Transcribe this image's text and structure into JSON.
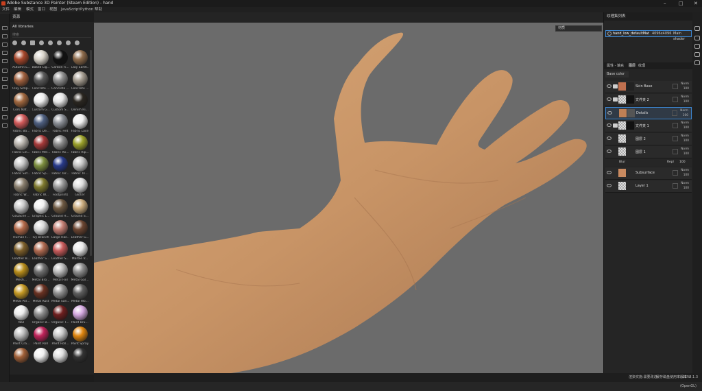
{
  "window": {
    "title": "Adobe Substance 3D Painter (Steam Edition) - hand",
    "minimize": "–",
    "maximize": "□",
    "close": "✕"
  },
  "menu": [
    "文件",
    "编辑",
    "模式",
    "窗口",
    "视图",
    "JavaScript",
    "Python",
    "帮助"
  ],
  "shelf": {
    "title": "资源",
    "path": "All libraries",
    "search_placeholder": "搜索",
    "items": [
      {
        "label": "Autumn L...",
        "color": "#a8472b"
      },
      {
        "label": "Baked Lig...",
        "color": "#d7d2c8"
      },
      {
        "label": "Carbon Fi...",
        "color": "#111111"
      },
      {
        "label": "Clay Earth...",
        "color": "#8d6a4a"
      },
      {
        "label": "Clay Simp...",
        "color": "#a0603e"
      },
      {
        "label": "Concrete ...",
        "color": "#5a5a5a"
      },
      {
        "label": "Concrete ...",
        "color": "#8d8d8d"
      },
      {
        "label": "Concrete ...",
        "color": "#a39b8f"
      },
      {
        "label": "Cork Nat...",
        "color": "#a1683f"
      },
      {
        "label": "Custom G...",
        "color": "#ececec"
      },
      {
        "label": "Custom S...",
        "color": "#e5e5e5"
      },
      {
        "label": "Denim Ri...",
        "color": "#2a2620"
      },
      {
        "label": "Fabric Ba...",
        "color": "#d25a5a"
      },
      {
        "label": "Fabric De...",
        "color": "#4e5f80"
      },
      {
        "label": "Fabric Felt",
        "color": "#8b8f96"
      },
      {
        "label": "Fabric Lace",
        "color": "#f0f0f0"
      },
      {
        "label": "Fabric Lin...",
        "color": "#b9b4ad"
      },
      {
        "label": "Fabric Mel...",
        "color": "#a63a3a"
      },
      {
        "label": "Fabric Ro...",
        "color": "#8a8a8a"
      },
      {
        "label": "Fabric Rip...",
        "color": "#9aa02a"
      },
      {
        "label": "Fabric Sof...",
        "color": "#c6c6c6"
      },
      {
        "label": "Fabric Sp...",
        "color": "#7d8f3f"
      },
      {
        "label": "Fabric Tar...",
        "color": "#283a8a"
      },
      {
        "label": "Fabric Tri...",
        "color": "#c2c2c2"
      },
      {
        "label": "Fabric W...",
        "color": "#8a7f6e"
      },
      {
        "label": "Fabric W...",
        "color": "#7f7a2e"
      },
      {
        "label": "Footprints",
        "color": "#9a9a9a"
      },
      {
        "label": "Glitter",
        "color": "#dcdcdc"
      },
      {
        "label": "Gouache ...",
        "color": "#c9c9c9"
      },
      {
        "label": "Graphic L...",
        "color": "#efefef"
      },
      {
        "label": "Ground H...",
        "color": "#6f5a43"
      },
      {
        "label": "Ground S...",
        "color": "#c9aa7c"
      },
      {
        "label": "Human F...",
        "color": "#b46a4a"
      },
      {
        "label": "Ivy Branch",
        "color": "#d8d8d8"
      },
      {
        "label": "Large Han...",
        "color": "#c27d72"
      },
      {
        "label": "Leather G...",
        "color": "#6b4531"
      },
      {
        "label": "Leather B...",
        "color": "#7d5f2a"
      },
      {
        "label": "Leather S...",
        "color": "#b06a50"
      },
      {
        "label": "Leather S...",
        "color": "#c65a5a"
      },
      {
        "label": "Marble V...",
        "color": "#e8e8e8"
      },
      {
        "label": "Mesh...",
        "color": "#b88d1a"
      },
      {
        "label": "Metal Bro...",
        "color": "#6f6f6f"
      },
      {
        "label": "Metal Foil",
        "color": "#b9b9b9"
      },
      {
        "label": "Metal Gal...",
        "color": "#8d8d8d"
      },
      {
        "label": "Metal Pol...",
        "color": "#c69a24"
      },
      {
        "label": "Metal Rust",
        "color": "#6a3222"
      },
      {
        "label": "Metal San...",
        "color": "#8f8f8f"
      },
      {
        "label": "Metal Wo...",
        "color": "#5e5e5e"
      },
      {
        "label": "Nail",
        "color": "#ececec"
      },
      {
        "label": "Organic B...",
        "color": "#8d8d8d"
      },
      {
        "label": "Organic T...",
        "color": "#6f1f1f"
      },
      {
        "label": "Paint Bru...",
        "color": "#d4a8e0"
      },
      {
        "label": "Paint Cra...",
        "color": "#bdbdbd"
      },
      {
        "label": "Paint Roll",
        "color": "#c0235a"
      },
      {
        "label": "Paint Roll...",
        "color": "#c7c7c7"
      },
      {
        "label": "Paint Spray",
        "color": "#e0860f"
      },
      {
        "label": "",
        "color": "#a06038"
      },
      {
        "label": "",
        "color": "#efefef"
      },
      {
        "label": "",
        "color": "#dedede"
      },
      {
        "label": "",
        "color": "#333333"
      }
    ]
  },
  "viewport": {
    "mode_select": "材质"
  },
  "texture_set": {
    "panel_title": "纹理集列表",
    "name": "hand_low_defaultMat",
    "resolution": "4096x4096",
    "shader": "Main shader"
  },
  "layers": {
    "tabs": [
      "属性 - 填充",
      "图层",
      "纹理"
    ],
    "blend_mode": "Base color",
    "items": [
      {
        "name": "Skin Base",
        "blend": "Norm",
        "opacity": "100",
        "thumb1": "#c0704f",
        "thumb2": "#222",
        "folder": true,
        "sel": false
      },
      {
        "name": "文件夹 2",
        "blend": "Norm",
        "opacity": "100",
        "thumb1": "chk",
        "thumb2": "#111",
        "folder": true,
        "sel": false
      },
      {
        "name": "Details",
        "blend": "Norm",
        "opacity": "100",
        "thumb1": "#c08055",
        "thumb2": "#555",
        "folder": false,
        "sel": true
      },
      {
        "name": "文件夹 1",
        "blend": "Norm",
        "opacity": "100",
        "thumb1": "chk",
        "thumb2": "#111",
        "folder": true,
        "sel": false
      },
      {
        "name": "图层 2",
        "blend": "Norm",
        "opacity": "100",
        "thumb1": "chk",
        "thumb2": "",
        "folder": false,
        "sel": false
      },
      {
        "name": "图层 1",
        "blend": "Norm",
        "opacity": "100",
        "thumb1": "chk",
        "thumb2": "",
        "folder": false,
        "sel": false
      }
    ],
    "sub_effect": {
      "name": "Blur",
      "blend": "Repl",
      "opacity": "100"
    },
    "items2": [
      {
        "name": "Subsurface",
        "blend": "Norm",
        "opacity": "100",
        "thumb1": "#c98a60"
      },
      {
        "name": "Layer 1",
        "blend": "Norm",
        "opacity": "100",
        "thumb1": "chk"
      }
    ]
  },
  "status": {
    "text": "渲染实施:需要改进",
    "cache": "缓存磁盘使用率: 12%",
    "version": "版本: 8.1.3 (OpenGL)"
  }
}
